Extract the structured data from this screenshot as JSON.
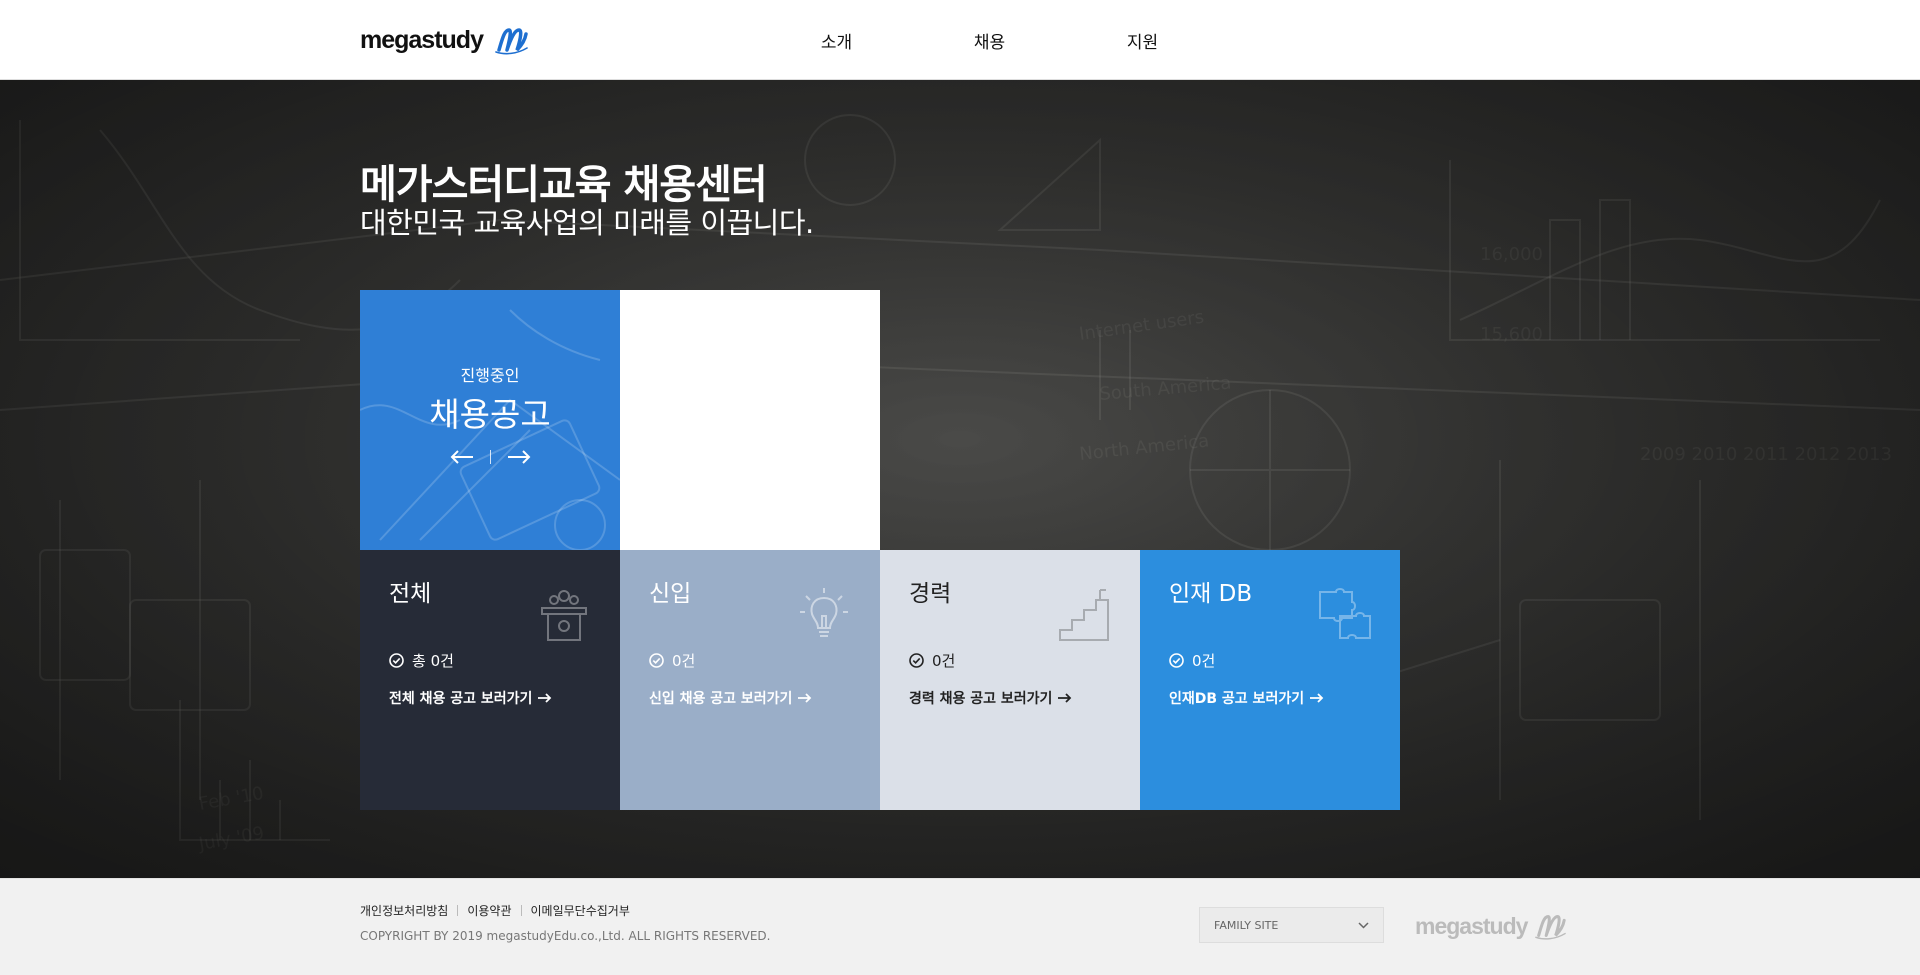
{
  "header": {
    "logo_text": "megastudy",
    "nav": [
      "소개",
      "채용",
      "지원"
    ]
  },
  "hero": {
    "title": "메가스터디교육 채용센터",
    "subtitle": "대한민국 교육사업의 미래를 이끕니다."
  },
  "featured": {
    "subtitle": "진행중인",
    "title": "채용공고",
    "color": "#2f7fd6"
  },
  "categories": [
    {
      "title": "전체",
      "count": "총 0건",
      "link": "전체 채용 공고 보러가기",
      "icon": "podium-icon",
      "color": "#262b37"
    },
    {
      "title": "신입",
      "count": "0건",
      "link": "신입 채용 공고 보러가기",
      "icon": "lightbulb-icon",
      "color": "#9aaec8"
    },
    {
      "title": "경력",
      "count": "0건",
      "link": "경력 채용 공고 보러가기",
      "icon": "stairs-icon",
      "color": "#dbe0e8"
    },
    {
      "title": "인재 DB",
      "count": "0건",
      "link": "인재DB 공고 보러가기",
      "icon": "puzzle-icon",
      "color": "#2c8ede"
    }
  ],
  "footer": {
    "links": [
      "개인정보처리방침",
      "이용약관",
      "이메일무단수집거부"
    ],
    "copyright": "COPYRIGHT BY 2019 megastudyEdu.co.,Ltd. ALL RIGHTS RESERVED.",
    "family_site": "FAMILY SITE",
    "logo_text": "megastudy"
  }
}
